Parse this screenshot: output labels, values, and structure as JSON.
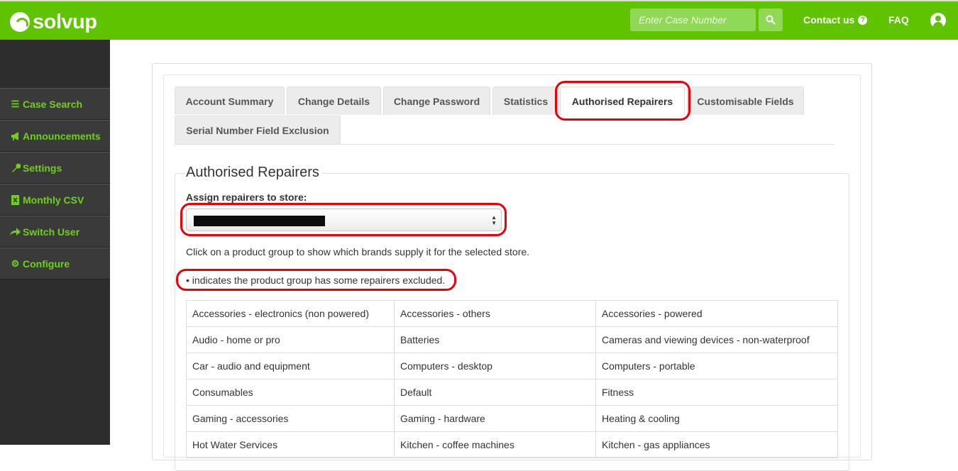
{
  "brand": {
    "name": "solvup",
    "color": "#5fc300"
  },
  "header": {
    "case_placeholder": "Enter Case Number",
    "contact_label": "Contact us",
    "faq_label": "FAQ",
    "search_icon": "search-icon",
    "user_icon": "user-circle-icon"
  },
  "sidebar": {
    "items": [
      {
        "label": "Case Search",
        "icon": "list-icon"
      },
      {
        "label": "Announcements",
        "icon": "megaphone-icon"
      },
      {
        "label": "Settings",
        "icon": "wrench-icon"
      },
      {
        "label": "Monthly CSV",
        "icon": "excel-file-icon"
      },
      {
        "label": "Switch User",
        "icon": "share-arrow-icon"
      },
      {
        "label": "Configure",
        "icon": "gears-icon"
      }
    ]
  },
  "tabs": [
    {
      "label": "Account Summary",
      "active": false
    },
    {
      "label": "Change Details",
      "active": false
    },
    {
      "label": "Change Password",
      "active": false
    },
    {
      "label": "Statistics",
      "active": false
    },
    {
      "label": "Authorised Repairers",
      "active": true
    },
    {
      "label": "Customisable Fields",
      "active": false
    },
    {
      "label": "Serial Number Field Exclusion",
      "active": false
    }
  ],
  "section": {
    "title": "Authorised Repairers",
    "assign_label": "Assign repairers to store:",
    "store_value": "",
    "hint": "Click on a product group to show which brands supply it for the selected store.",
    "bullet_note": "• indicates the product group has some repairers excluded."
  },
  "product_groups": [
    [
      "Accessories - electronics (non powered)",
      "Accessories - others",
      "Accessories - powered"
    ],
    [
      "Audio - home or pro",
      "Batteries",
      "Cameras and viewing devices - non-waterproof"
    ],
    [
      "Car - audio and equipment",
      "Computers - desktop",
      "Computers - portable"
    ],
    [
      "Consumables",
      "Default",
      "Fitness"
    ],
    [
      "Gaming - accessories",
      "Gaming - hardware",
      "Heating & cooling"
    ],
    [
      "Hot Water Services",
      "Kitchen - coffee machines",
      "Kitchen - gas appliances"
    ]
  ],
  "highlight_color": "#e8000b"
}
